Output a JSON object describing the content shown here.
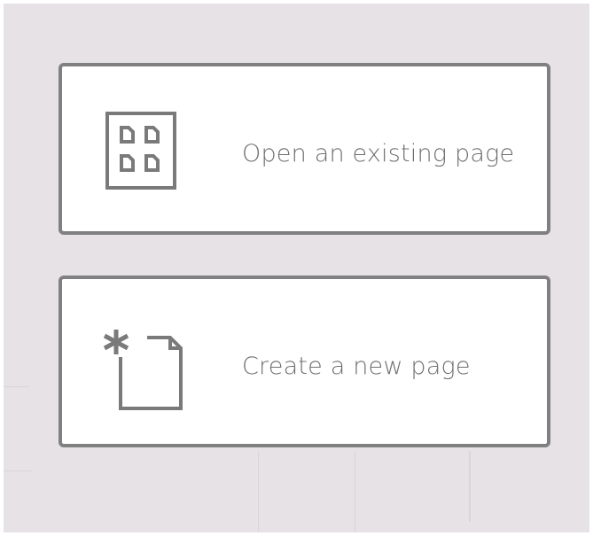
{
  "actions": [
    {
      "label": "Open an existing page",
      "icon": "page-grid-icon"
    },
    {
      "label": "Create a new page",
      "icon": "new-page-icon"
    }
  ],
  "colors": {
    "backdrop": "#e6e2e5",
    "card_border": "#808080",
    "icon": "#7a7a7a",
    "label": "#707070"
  }
}
